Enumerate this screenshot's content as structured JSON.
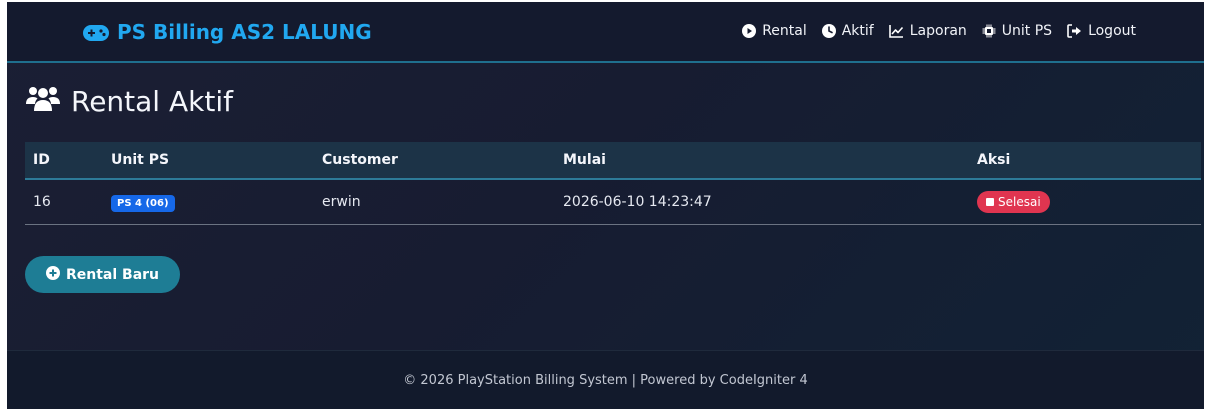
{
  "navbar": {
    "brand": "PS Billing AS2 LALUNG",
    "links": [
      {
        "label": "Rental",
        "icon": "play-circle-icon"
      },
      {
        "label": "Aktif",
        "icon": "clock-icon"
      },
      {
        "label": "Laporan",
        "icon": "chart-line-icon"
      },
      {
        "label": "Unit PS",
        "icon": "chip-icon"
      },
      {
        "label": "Logout",
        "icon": "logout-icon"
      }
    ]
  },
  "page": {
    "title": "Rental Aktif",
    "title_icon": "users-icon"
  },
  "table": {
    "headers": [
      "ID",
      "Unit PS",
      "Customer",
      "Mulai",
      "Aksi"
    ],
    "rows": [
      {
        "id": "16",
        "unit": "PS 4 (06)",
        "customer": "erwin",
        "start": "2026-06-10 14:23:47",
        "action": "Selesai"
      }
    ]
  },
  "actions": {
    "new_rental": "Rental Baru"
  },
  "footer": {
    "text": "© 2026 PlayStation Billing System | Powered by CodeIgniter 4"
  },
  "colors": {
    "brand": "#21a8f0",
    "accent": "#1e7d95",
    "danger": "#e03550",
    "badge": "#1668e8",
    "background": "#171c31"
  }
}
